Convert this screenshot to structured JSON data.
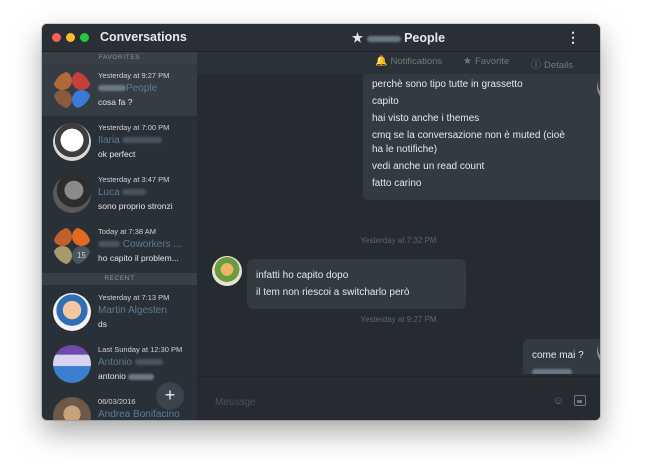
{
  "window": {
    "sidebar_title": "Conversations",
    "chat_title_prefix": "★",
    "chat_title": "People"
  },
  "sidebar": {
    "favorites_header": "FAVORITES",
    "recent_header": "RECENT",
    "favorites": [
      {
        "time": "Yesterday at 9:27 PM",
        "name": "People",
        "preview": "cosa fa ?"
      },
      {
        "time": "Yesterday at 7:00 PM",
        "name": "Ilaria",
        "preview": "ok perfect"
      },
      {
        "time": "Yesterday at 3:47 PM",
        "name": "Luca",
        "preview": "sono proprio stronzi"
      },
      {
        "time": "Today at 7:38 AM",
        "name": "Coworkers ...",
        "preview": "ho capito il problem...",
        "badge": "15"
      }
    ],
    "recent": [
      {
        "time": "Yesterday at 7:13 PM",
        "name": "Martin Algesten",
        "preview": "ds"
      },
      {
        "time": "Last Sunday at 12:30 PM",
        "name": "Antonio",
        "preview": "antonio"
      },
      {
        "time": "06/03/2016",
        "name": "Andrea Bonifacino",
        "preview": ""
      }
    ],
    "add_label": "+"
  },
  "toolbar": {
    "notifications": "Notifications",
    "favorite": "Favorite",
    "details": "Details"
  },
  "messages": {
    "block1": [
      "perchè sono tipo tutte in grassetto",
      "capito",
      "hai visto anche i themes",
      "cmq se la conversazione non è muted (cioè",
      "ha le notifiche)",
      "vedi anche un read count",
      "fatto carino"
    ],
    "stamp1": "Yesterday at 7:32 PM",
    "block2": [
      "infatti ho capito dopo",
      "il tem non riescoi a switcharlo però"
    ],
    "stamp2": "Yesterday at 9:27 PM",
    "block3": [
      "come mai ?"
    ]
  },
  "composer": {
    "placeholder": "Message"
  },
  "colors": {
    "accent_name": "#5b7d99",
    "bg": "#262b31",
    "sidebar": "#2a3037"
  }
}
